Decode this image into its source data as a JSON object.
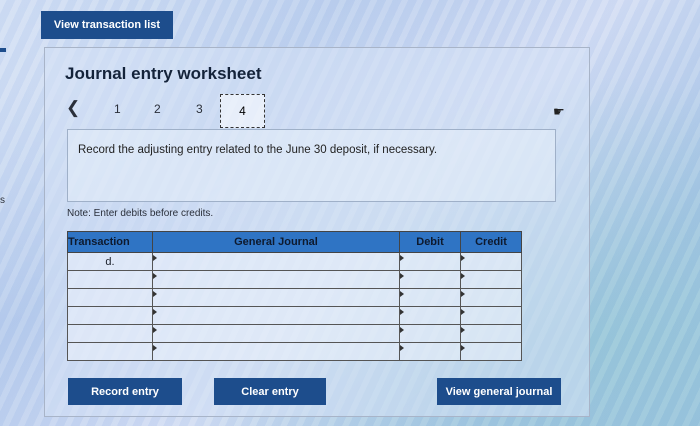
{
  "top_button": {
    "label": "View transaction list"
  },
  "worksheet": {
    "title": "Journal entry worksheet",
    "pager": {
      "prev_icon": "chevron-left-icon",
      "pages": [
        "1",
        "2",
        "3",
        "4"
      ],
      "active_page": "4"
    },
    "instruction": "Record the adjusting entry related to the June 30 deposit, if necessary.",
    "note": "Note: Enter debits before credits."
  },
  "table": {
    "headers": {
      "transaction": "Transaction",
      "general_journal": "General Journal",
      "debit": "Debit",
      "credit": "Credit"
    },
    "rows": [
      {
        "transaction": "d.",
        "general_journal": "",
        "debit": "",
        "credit": ""
      },
      {
        "transaction": "",
        "general_journal": "",
        "debit": "",
        "credit": ""
      },
      {
        "transaction": "",
        "general_journal": "",
        "debit": "",
        "credit": ""
      },
      {
        "transaction": "",
        "general_journal": "",
        "debit": "",
        "credit": ""
      },
      {
        "transaction": "",
        "general_journal": "",
        "debit": "",
        "credit": ""
      },
      {
        "transaction": "",
        "general_journal": "",
        "debit": "",
        "credit": ""
      }
    ],
    "header_color": "#2f74c4"
  },
  "actions": {
    "record_entry": "Record entry",
    "clear_entry": "Clear entry",
    "view_general_journal": "View general journal"
  },
  "edge_text": "s",
  "colors": {
    "button": "#1d4d8c"
  }
}
